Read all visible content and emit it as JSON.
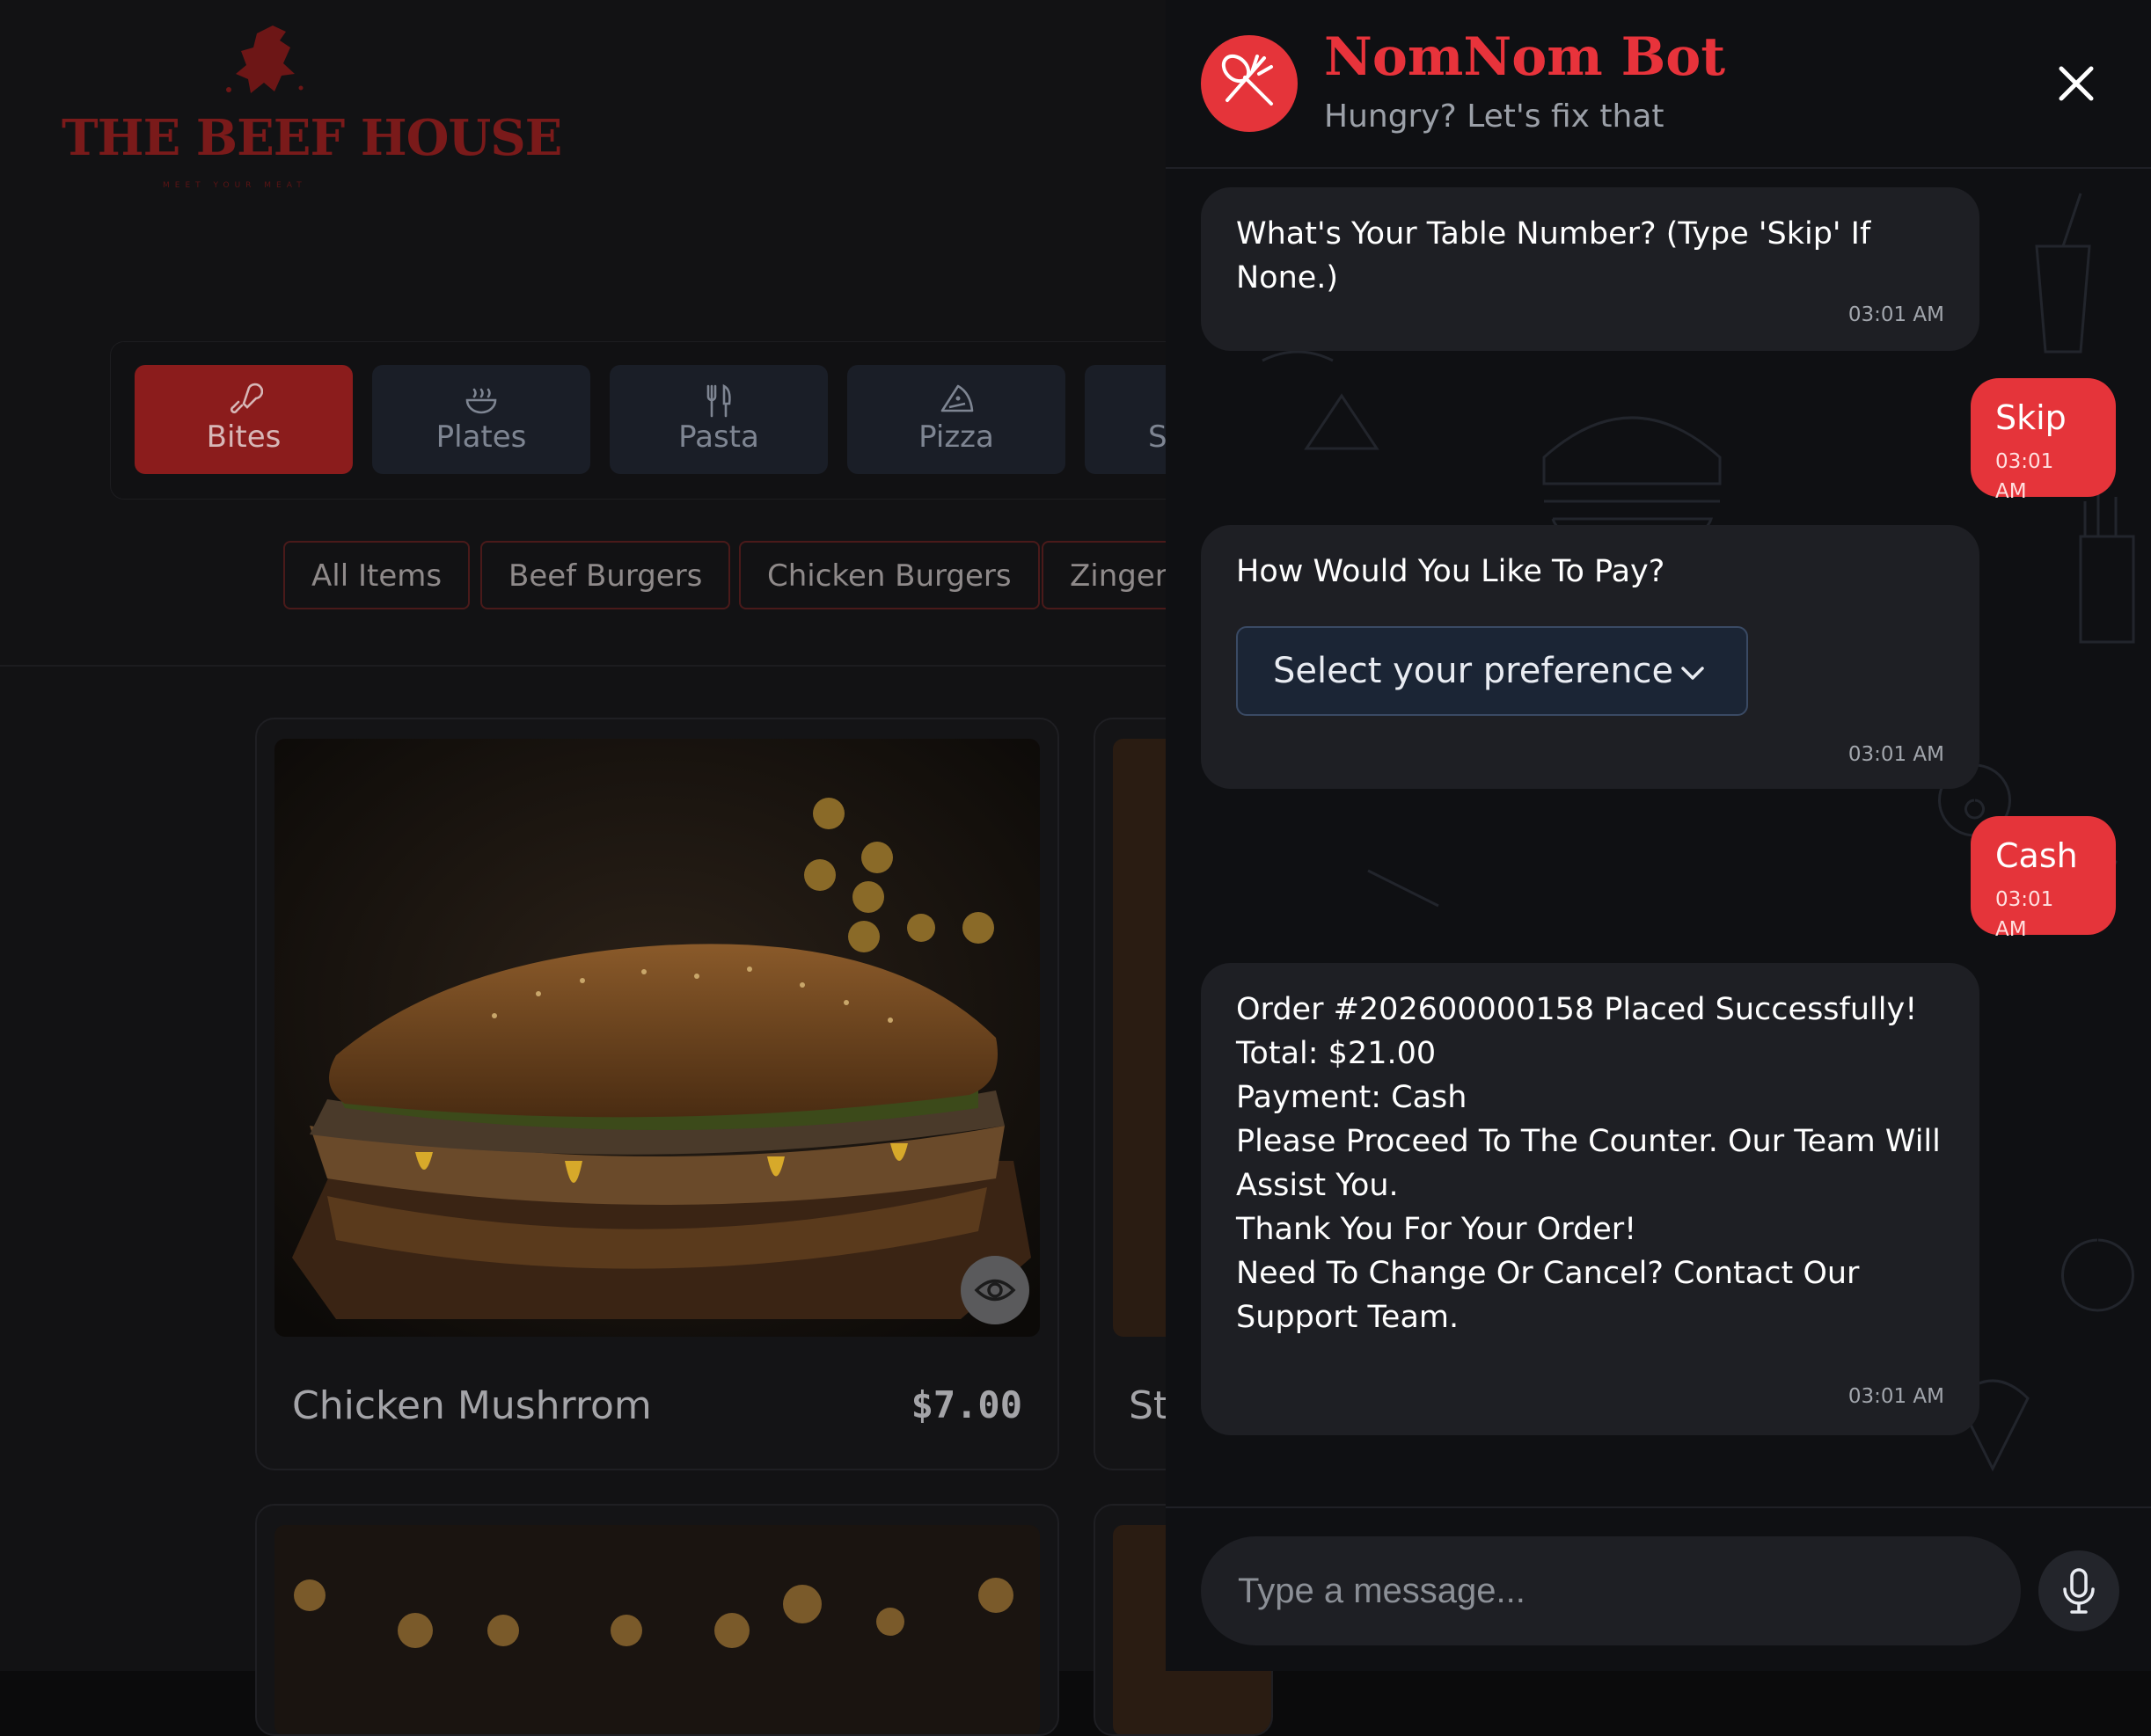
{
  "menu": {
    "logo": {
      "text": "THE BEEF HOUSE",
      "tagline": "MEET YOUR MEAT"
    },
    "categories": [
      {
        "label": "Bites",
        "icon": "drumstick-icon",
        "active": true
      },
      {
        "label": "Plates",
        "icon": "bowl-icon",
        "active": false
      },
      {
        "label": "Pasta",
        "icon": "fork-knife-icon",
        "active": false
      },
      {
        "label": "Pizza",
        "icon": "pizza-icon",
        "active": false
      },
      {
        "label": "S",
        "icon": "partial-icon",
        "active": false
      }
    ],
    "filters": [
      "All Items",
      "Beef Burgers",
      "Chicken Burgers",
      "Zinger"
    ],
    "items": [
      {
        "title": "Chicken Mushrrom",
        "price": "$7.00"
      },
      {
        "title": "St",
        "price": ""
      }
    ]
  },
  "chat": {
    "title": "NomNom Bot",
    "subtitle": "Hungry? Let's fix that",
    "messages": {
      "m1": {
        "text": "What's Your Table Number? (Type 'Skip' If None.)",
        "time": "03:01 AM"
      },
      "u1": {
        "text": "Skip",
        "time": "03:01 AM"
      },
      "m2": {
        "text": "How Would You Like To Pay?",
        "time": "03:01 AM",
        "select_value": "Select your preference"
      },
      "u2": {
        "text": "Cash",
        "time": "03:01 AM"
      },
      "m3": {
        "lines": [
          "Order #202600000158 Placed Successfully!",
          "Total: $21.00",
          "Payment: Cash",
          "Please Proceed To The Counter. Our Team Will Assist You.",
          "Thank You For Your Order!",
          "Need To Change Or Cancel? Contact Our Support Team."
        ],
        "time": "03:01 AM"
      }
    },
    "input_placeholder": "Type a message...",
    "accent": "#e5343a"
  }
}
